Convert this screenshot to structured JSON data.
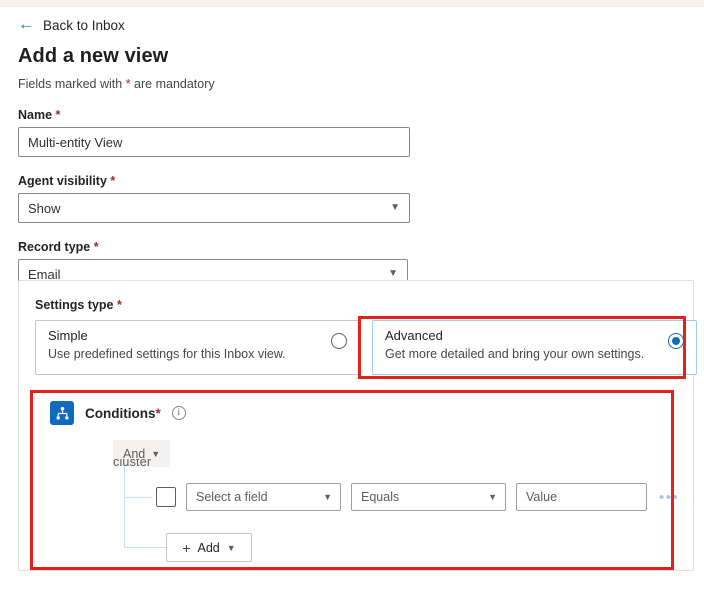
{
  "back": {
    "label": "Back to Inbox",
    "icon": "arrow-left-icon"
  },
  "header": {
    "title": "Add a new view",
    "mandatory_note_before": "Fields marked with ",
    "mandatory_note_asterisk": "*",
    "mandatory_note_after": " are mandatory"
  },
  "form": {
    "name": {
      "label": "Name",
      "required": "*",
      "value": "Multi-entity View"
    },
    "agent_visibility": {
      "label": "Agent visibility",
      "required": "*",
      "value": "Show",
      "chevron": "chevron-down-icon"
    },
    "record_type": {
      "label": "Record type",
      "required": "*",
      "value": "Email",
      "chevron": "chevron-down-icon"
    }
  },
  "settings": {
    "label": "Settings type",
    "required": "*",
    "options": [
      {
        "title": "Simple",
        "description": "Use predefined settings for this Inbox view.",
        "selected": false
      },
      {
        "title": "Advanced",
        "description": "Get more detailed and bring your own settings.",
        "selected": true
      }
    ]
  },
  "conditions": {
    "icon": "conditions-hierarchy-icon",
    "title": "Conditions",
    "required": "*",
    "info_icon": "info-icon",
    "info_glyph": "i",
    "logic_operator": "And",
    "logic_chevron": "chevron-down-icon",
    "artifact_text": "cluster",
    "row": {
      "field_placeholder": "Select a field",
      "operator_value": "Equals",
      "value_placeholder": "Value",
      "overflow": "•••"
    },
    "add_button": {
      "plus": "+",
      "label": "Add",
      "chevron": "chevron-down-icon"
    }
  },
  "colors": {
    "accent": "#0f6cbd",
    "annotation": "#e2231a",
    "required": "#a4262c"
  }
}
